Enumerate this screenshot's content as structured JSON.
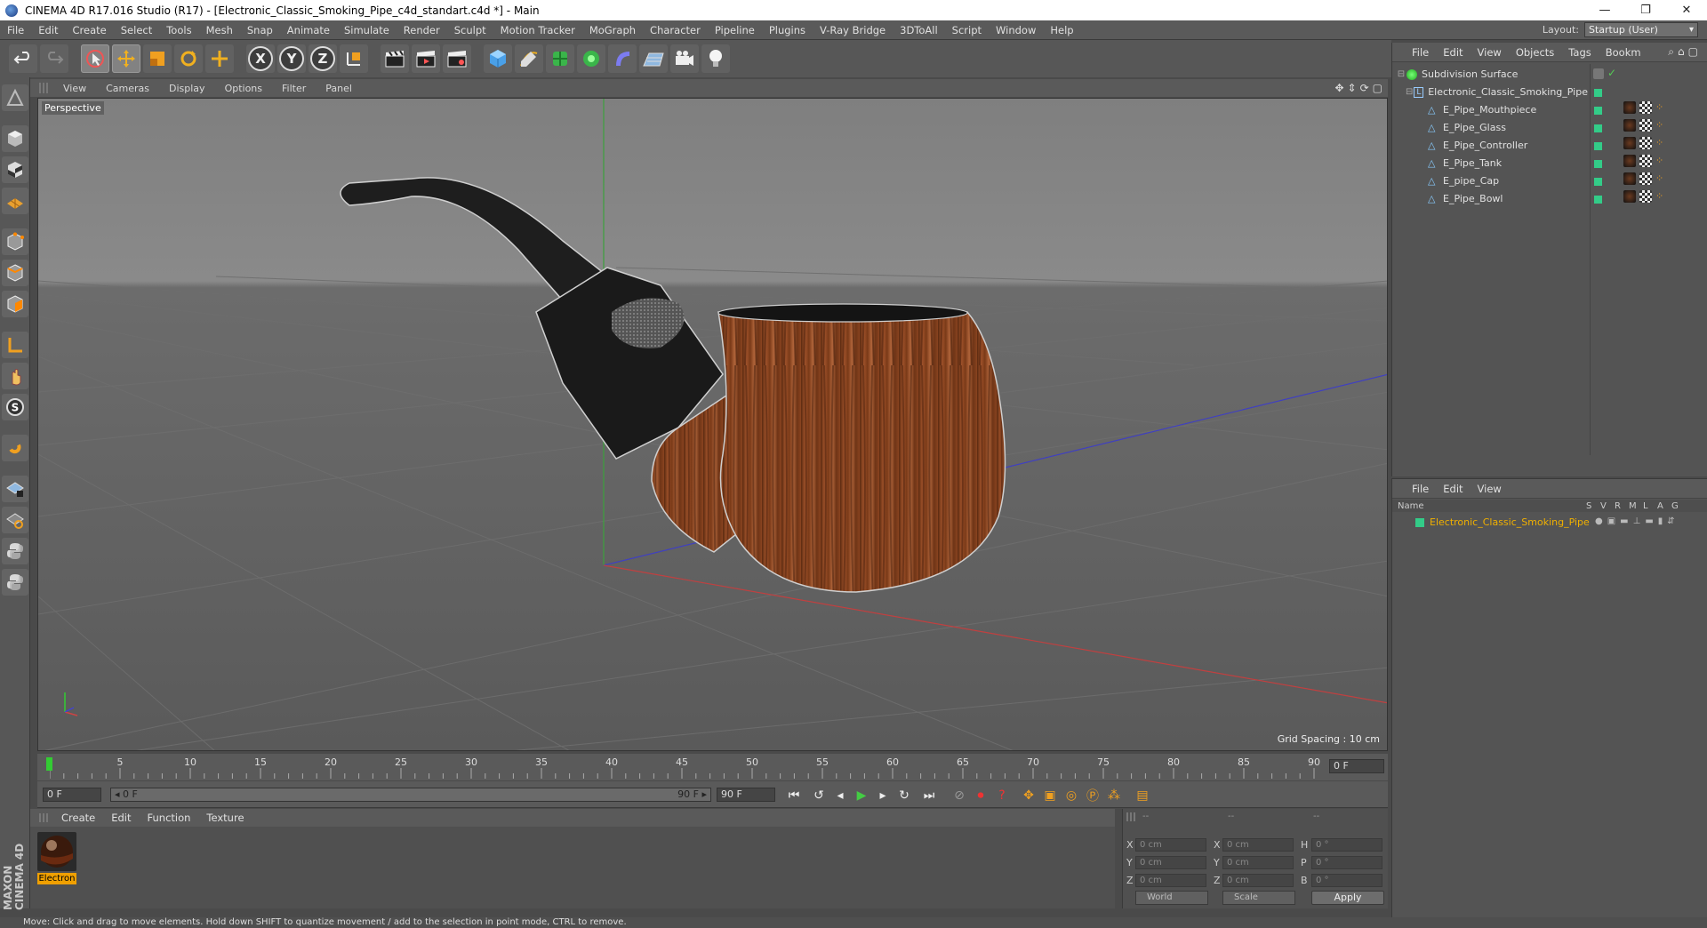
{
  "window": {
    "title": "CINEMA 4D R17.016 Studio (R17) - [Electronic_Classic_Smoking_Pipe_c4d_standart.c4d *] - Main",
    "controls": [
      "—",
      "❐",
      "✕"
    ]
  },
  "menubar": {
    "items": [
      "File",
      "Edit",
      "Create",
      "Select",
      "Tools",
      "Mesh",
      "Snap",
      "Animate",
      "Simulate",
      "Render",
      "Sculpt",
      "Motion Tracker",
      "MoGraph",
      "Character",
      "Pipeline",
      "Plugins",
      "V-Ray Bridge",
      "3DToAll",
      "Script",
      "Window",
      "Help"
    ],
    "layout_label": "Layout:",
    "layout_value": "Startup (User)"
  },
  "toolbar": {
    "axis_x": "X",
    "axis_y": "Y",
    "axis_z": "Z"
  },
  "viewport": {
    "menu": [
      "View",
      "Cameras",
      "Display",
      "Options",
      "Filter",
      "Panel"
    ],
    "label": "Perspective",
    "grid_spacing": "Grid Spacing : 10 cm"
  },
  "timeline": {
    "ticks": [
      "0",
      "5",
      "10",
      "15",
      "20",
      "25",
      "30",
      "35",
      "40",
      "45",
      "50",
      "55",
      "60",
      "65",
      "70",
      "75",
      "80",
      "85",
      "90"
    ],
    "current_frame": "0 F",
    "start_field": "0 F",
    "range_start": "◂ 0 F",
    "range_end": "90 F ▸",
    "end_field": "90 F"
  },
  "material_manager": {
    "menu": [
      "Create",
      "Edit",
      "Function",
      "Texture"
    ],
    "material_name": "Electron"
  },
  "coordinates": {
    "headers": [
      "--",
      "--",
      "--"
    ],
    "rows": [
      {
        "l1": "X",
        "v1": "0 cm",
        "l2": "X",
        "v2": "0 cm",
        "l3": "H",
        "v3": "0 °"
      },
      {
        "l1": "Y",
        "v1": "0 cm",
        "l2": "Y",
        "v2": "0 cm",
        "l3": "P",
        "v3": "0 °"
      },
      {
        "l1": "Z",
        "v1": "0 cm",
        "l2": "Z",
        "v2": "0 cm",
        "l3": "B",
        "v3": "0 °"
      }
    ],
    "mode_world": "World",
    "mode_scale": "Scale",
    "apply": "Apply"
  },
  "object_manager": {
    "menu": [
      "File",
      "Edit",
      "View",
      "Objects",
      "Tags",
      "Bookm"
    ],
    "objects": [
      {
        "name": "Subdivision Surface",
        "level": 0
      },
      {
        "name": "Electronic_Classic_Smoking_Pipe",
        "level": 1
      },
      {
        "name": "E_Pipe_Mouthpiece",
        "level": 2
      },
      {
        "name": "E_Pipe_Glass",
        "level": 2
      },
      {
        "name": "E_Pipe_Controller",
        "level": 2
      },
      {
        "name": "E_Pipe_Tank",
        "level": 2
      },
      {
        "name": "E_pipe_Cap",
        "level": 2
      },
      {
        "name": "E_Pipe_Bowl",
        "level": 2
      }
    ]
  },
  "layer_manager": {
    "menu": [
      "File",
      "Edit",
      "View"
    ],
    "columns": [
      "Name",
      "S",
      "V",
      "R",
      "M",
      "L",
      "A",
      "G"
    ],
    "layer": "Electronic_Classic_Smoking_Pipe"
  },
  "status": {
    "text": "Move: Click and drag to move elements. Hold down SHIFT to quantize movement / add to the selection in point mode, CTRL to remove."
  },
  "brand": {
    "logo_text": "MAXON CINEMA 4D"
  }
}
